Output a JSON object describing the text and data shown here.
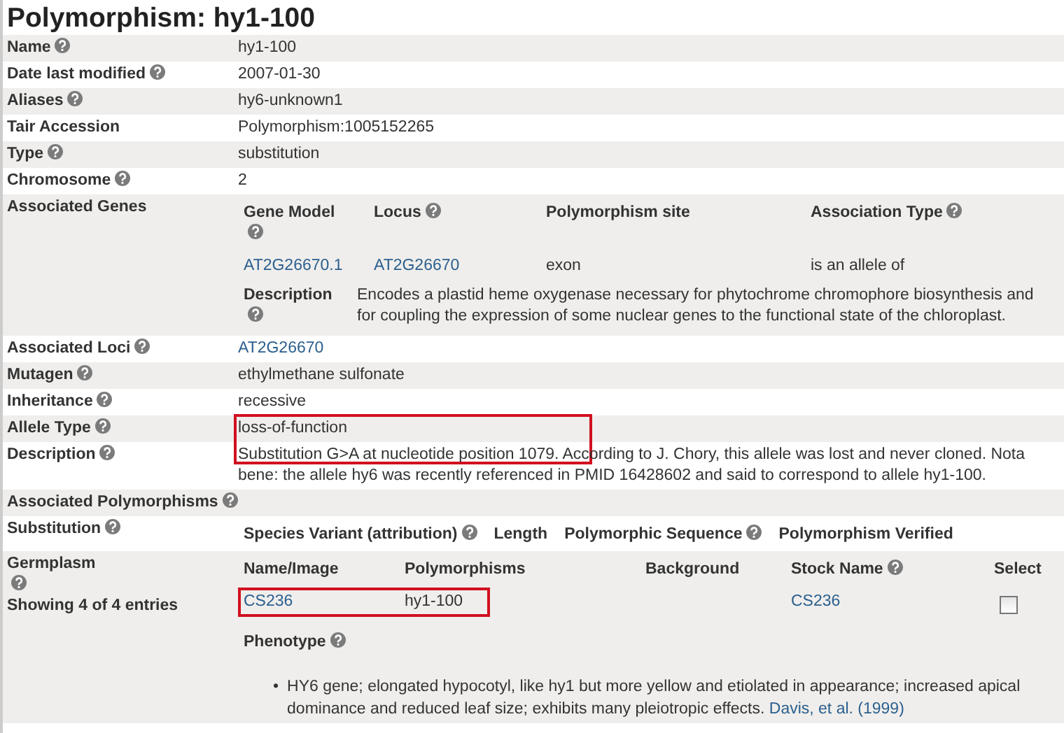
{
  "title": "Polymorphism: hy1-100",
  "fields": [
    {
      "kind": "text",
      "label": "Name",
      "help": true,
      "value": "hy1-100"
    },
    {
      "kind": "text",
      "label": "Date last modified",
      "help": true,
      "value": "2007-01-30"
    },
    {
      "kind": "text",
      "label": "Aliases",
      "help": true,
      "value": "hy6-unknown1"
    },
    {
      "kind": "text",
      "label": "Tair Accession",
      "help": false,
      "value": "Polymorphism:1005152265"
    },
    {
      "kind": "text",
      "label": "Type",
      "help": true,
      "value": "substitution"
    },
    {
      "kind": "text",
      "label": "Chromosome",
      "help": true,
      "value": "2"
    },
    {
      "kind": "genes",
      "label": "Associated Genes",
      "help": false,
      "columns": [
        {
          "label": "Gene Model",
          "help": true
        },
        {
          "label": "Locus",
          "help": true
        },
        {
          "label": "Polymorphism site",
          "help": false
        },
        {
          "label": "Association Type",
          "help": true
        }
      ],
      "rows": [
        {
          "gene_model": "AT2G26670.1",
          "locus": "AT2G26670",
          "site": "exon",
          "association": "is an allele of"
        }
      ],
      "description_label": "Description",
      "description": "Encodes a plastid heme oxygenase necessary for phytochrome chromophore biosynthesis and for coupling the expression of some nuclear genes to the functional state of the chloroplast."
    },
    {
      "kind": "link",
      "label": "Associated Loci",
      "help": true,
      "value": "AT2G26670"
    },
    {
      "kind": "text",
      "label": "Mutagen",
      "help": true,
      "value": "ethylmethane sulfonate"
    },
    {
      "kind": "text",
      "label": "Inheritance",
      "help": true,
      "value": "recessive"
    },
    {
      "kind": "text",
      "label": "Allele Type",
      "help": true,
      "value": "loss-of-function",
      "highlighted": true
    },
    {
      "kind": "text",
      "label": "Description",
      "help": true,
      "value": "Substitution G>A at nucleotide position 1079. According to J. Chory, this allele was lost and never cloned. Nota bene: the allele hy6 was recently referenced in PMID 16428602 and said to correspond to allele hy1-100."
    },
    {
      "kind": "section",
      "label": "Associated Polymorphisms",
      "help": true
    },
    {
      "kind": "substitution",
      "label": "Substitution",
      "help": true,
      "columns": [
        {
          "label": "Species Variant (attribution)",
          "help": true
        },
        {
          "label": "Length",
          "help": false
        },
        {
          "label": "Polymorphic Sequence",
          "help": true
        },
        {
          "label": "Polymorphism Verified",
          "help": false
        }
      ]
    },
    {
      "kind": "germplasm",
      "label": "Germplasm",
      "help": true,
      "count": "Showing 4 of 4 entries",
      "columns": [
        {
          "label": "Name/Image",
          "help": false
        },
        {
          "label": "Polymorphisms",
          "help": false
        },
        {
          "label": "Background",
          "help": false
        },
        {
          "label": "Stock Name",
          "help": true
        },
        {
          "label": "Select",
          "help": false
        }
      ],
      "rows": [
        {
          "name": "CS236",
          "polymorphisms": "hy1-100",
          "stock_name": "CS236",
          "checked": false,
          "highlighted": true
        }
      ],
      "phenotype_label": "Phenotype",
      "phenotypes": [
        {
          "marker": "•",
          "text": "HY6 gene; elongated hypocotyl, like hy1 but more yellow and etiolated in appearance; increased apical dominance and reduced leaf size; exhibits many pleiotropic effects.",
          "citation": "Davis, et al. (1999)"
        }
      ]
    }
  ]
}
